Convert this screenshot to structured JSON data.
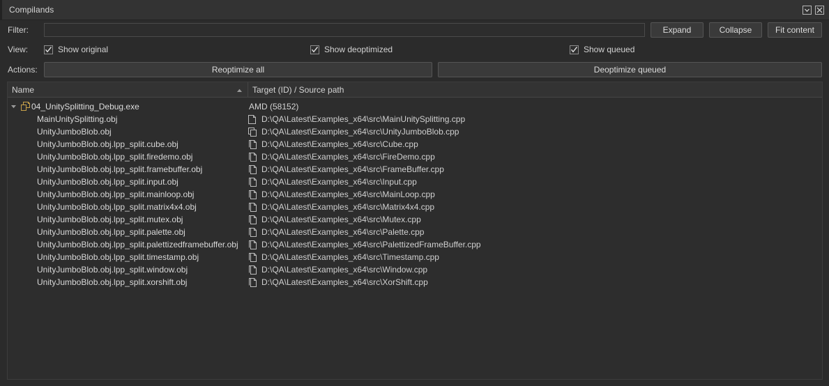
{
  "window": {
    "title": "Compilands",
    "controls": [
      {
        "name": "chevron-down-icon",
        "label": "Minimize"
      },
      {
        "name": "close-icon",
        "label": "Close"
      }
    ]
  },
  "toolbar": {
    "filter": {
      "label": "Filter:",
      "value": "",
      "placeholder": ""
    },
    "buttons": {
      "expand": "Expand",
      "collapse": "Collapse",
      "fit_content": "Fit content"
    },
    "view": {
      "label": "View:",
      "checkboxes": [
        {
          "label": "Show original",
          "checked": true
        },
        {
          "label": "Show deoptimized",
          "checked": true
        },
        {
          "label": "Show queued",
          "checked": true
        }
      ]
    },
    "actions": {
      "label": "Actions:",
      "reoptimize_all": "Reoptimize all",
      "deoptimize_queued": "Deoptimize queued"
    }
  },
  "tree": {
    "columns": [
      {
        "label": "Name",
        "sorted": "asc"
      },
      {
        "label": "Target (ID) / Source path",
        "sorted": "none"
      }
    ],
    "rows": [
      {
        "level": 0,
        "expanded": true,
        "icon": "executable-icon",
        "name": "04_UnitySplitting_Debug.exe",
        "target_icon": "none",
        "target": "AMD (58152)"
      },
      {
        "level": 1,
        "icon": "none",
        "name": "MainUnitySplitting.obj",
        "target_icon": "single-page-icon",
        "target": "D:\\QA\\Latest\\Examples_x64\\src\\MainUnitySplitting.cpp"
      },
      {
        "level": 1,
        "icon": "none",
        "name": "UnityJumboBlob.obj",
        "target_icon": "stacked-pages-icon",
        "target": "D:\\QA\\Latest\\Examples_x64\\src\\UnityJumboBlob.cpp"
      },
      {
        "level": 1,
        "icon": "none",
        "name": "UnityJumboBlob.obj.lpp_split.cube.obj",
        "target_icon": "two-pages-icon",
        "target": "D:\\QA\\Latest\\Examples_x64\\src\\Cube.cpp"
      },
      {
        "level": 1,
        "icon": "none",
        "name": "UnityJumboBlob.obj.lpp_split.firedemo.obj",
        "target_icon": "two-pages-icon",
        "target": "D:\\QA\\Latest\\Examples_x64\\src\\FireDemo.cpp"
      },
      {
        "level": 1,
        "icon": "none",
        "name": "UnityJumboBlob.obj.lpp_split.framebuffer.obj",
        "target_icon": "two-pages-icon",
        "target": "D:\\QA\\Latest\\Examples_x64\\src\\FrameBuffer.cpp"
      },
      {
        "level": 1,
        "icon": "none",
        "name": "UnityJumboBlob.obj.lpp_split.input.obj",
        "target_icon": "two-pages-icon",
        "target": "D:\\QA\\Latest\\Examples_x64\\src\\Input.cpp"
      },
      {
        "level": 1,
        "icon": "none",
        "name": "UnityJumboBlob.obj.lpp_split.mainloop.obj",
        "target_icon": "two-pages-icon",
        "target": "D:\\QA\\Latest\\Examples_x64\\src\\MainLoop.cpp"
      },
      {
        "level": 1,
        "icon": "none",
        "name": "UnityJumboBlob.obj.lpp_split.matrix4x4.obj",
        "target_icon": "two-pages-icon",
        "target": "D:\\QA\\Latest\\Examples_x64\\src\\Matrix4x4.cpp"
      },
      {
        "level": 1,
        "icon": "none",
        "name": "UnityJumboBlob.obj.lpp_split.mutex.obj",
        "target_icon": "two-pages-icon",
        "target": "D:\\QA\\Latest\\Examples_x64\\src\\Mutex.cpp"
      },
      {
        "level": 1,
        "icon": "none",
        "name": "UnityJumboBlob.obj.lpp_split.palette.obj",
        "target_icon": "two-pages-icon",
        "target": "D:\\QA\\Latest\\Examples_x64\\src\\Palette.cpp"
      },
      {
        "level": 1,
        "icon": "none",
        "name": "UnityJumboBlob.obj.lpp_split.palettizedframebuffer.obj",
        "target_icon": "two-pages-icon",
        "target": "D:\\QA\\Latest\\Examples_x64\\src\\PalettizedFrameBuffer.cpp"
      },
      {
        "level": 1,
        "icon": "none",
        "name": "UnityJumboBlob.obj.lpp_split.timestamp.obj",
        "target_icon": "two-pages-icon",
        "target": "D:\\QA\\Latest\\Examples_x64\\src\\Timestamp.cpp"
      },
      {
        "level": 1,
        "icon": "none",
        "name": "UnityJumboBlob.obj.lpp_split.window.obj",
        "target_icon": "two-pages-icon",
        "target": "D:\\QA\\Latest\\Examples_x64\\src\\Window.cpp"
      },
      {
        "level": 1,
        "icon": "none",
        "name": "UnityJumboBlob.obj.lpp_split.xorshift.obj",
        "target_icon": "two-pages-icon",
        "target": "D:\\QA\\Latest\\Examples_x64\\src\\XorShift.cpp"
      }
    ]
  },
  "colors": {
    "window_bg": "#2b2b2b",
    "titlebar_bg": "#333333",
    "panel_bg": "#2d2d2d",
    "button_bg": "#3a3a3a",
    "border": "#555555",
    "text": "#d4d4d4"
  }
}
